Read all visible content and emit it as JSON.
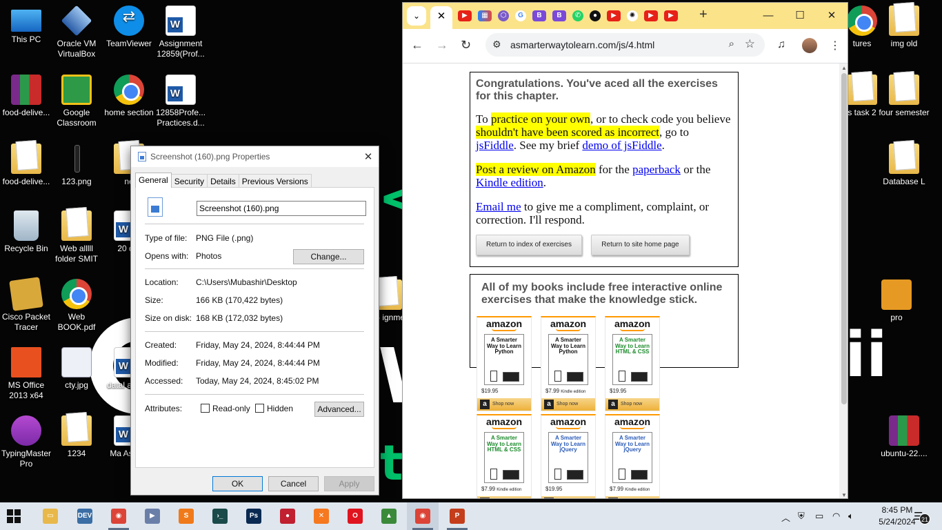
{
  "desktop": {
    "icons": {
      "this_pc": "This PC",
      "vbox": "Oracle VM VirtualBox",
      "teamviewer": "TeamViewer",
      "assignment": "Assignment 12859(Prof...",
      "food1": "food-delive...",
      "classroom": "Google Classroom",
      "home_section": "home section",
      "practices": "12858Profe... Practices.d...",
      "food2": "food-delive...",
      "png123": "123.png",
      "ne": "ne",
      "recycle": "Recycle Bin",
      "web_folder": "Web alllll folder   SMIT",
      "twenty": "20 dat",
      "cisco": "Cisco Packet Tracer",
      "web_book": "Web BOOK.pdf",
      "office": "MS Office 2013 x64",
      "cty": "cty.jpg",
      "datab": "datal assign",
      "typing": "TypingMaster Pro",
      "n1234": "1234",
      "ma": "Ma Assign",
      "js": "Js- ignme",
      "tures": "tures",
      "img_old": "img old",
      "s_task2": "s task 2",
      "four_sem": "four semester",
      "database": "Database L",
      "pro": "pro",
      "ubuntu": "ubuntu-22...."
    }
  },
  "properties_dialog": {
    "title": "Screenshot (160).png Properties",
    "tabs": [
      "General",
      "Security",
      "Details",
      "Previous Versions"
    ],
    "filename": "Screenshot (160).png",
    "type_label": "Type of file:",
    "type_value": "PNG File (.png)",
    "opens_label": "Opens with:",
    "opens_value": "Photos",
    "change_button": "Change...",
    "location_label": "Location:",
    "location_value": "C:\\Users\\Mubashir\\Desktop",
    "size_label": "Size:",
    "size_value": "166 KB (170,422 bytes)",
    "size_disk_label": "Size on disk:",
    "size_disk_value": "168 KB (172,032 bytes)",
    "created_label": "Created:",
    "created_value": "Friday, May 24, 2024, 8:44:44 PM",
    "modified_label": "Modified:",
    "modified_value": "Friday, May 24, 2024, 8:44:44 PM",
    "accessed_label": "Accessed:",
    "accessed_value": "Today, May 24, 2024, 8:45:02 PM",
    "attributes_label": "Attributes:",
    "readonly_label": "Read-only",
    "hidden_label": "Hidden",
    "advanced_button": "Advanced...",
    "ok_button": "OK",
    "cancel_button": "Cancel",
    "apply_button": "Apply"
  },
  "browser": {
    "url": "asmarterwaytolearn.com/js/4.html",
    "favicons": [
      "youtube",
      "jira",
      "proton",
      "google",
      "bing",
      "bing",
      "whatsapp",
      "github",
      "youtube",
      "chatgpt",
      "youtube",
      "youtube"
    ],
    "page": {
      "congrats_heading": "Congratulations. You've aced all the exercises for this chapter.",
      "p1_a": "To ",
      "p1_hl1": "practice on your own",
      "p1_b": ", or to check code you believe ",
      "p1_hl2": "shouldn't have been scored as incorrect",
      "p1_c": ", go to ",
      "p1_link1": "jsFiddle",
      "p1_d": ". See my brief ",
      "p1_link2": "demo of jsFiddle",
      "p1_e": ".",
      "p2_hl": "Post a review on Amazon",
      "p2_a": " for the ",
      "p2_link1": "paperback",
      "p2_b": " or the ",
      "p2_link2": "Kindle edition",
      "p2_c": ".",
      "p3_link": "Email me",
      "p3_a": " to give me a compliment, complaint, or correction. I'll respond.",
      "btn_index": "Return to index of exercises",
      "btn_home": "Return to site home page",
      "books_heading": "All of my books include free interactive online exercises that make the knowledge stick.",
      "books": [
        {
          "brand": "amazon",
          "title": "A Smarter Way to Learn Python",
          "price": "$19.95",
          "edition": "",
          "shop": "Shop now",
          "color": "#111111"
        },
        {
          "brand": "amazon",
          "title": "A Smarter Way to Learn Python",
          "price": "$7.99",
          "edition": "Kindle edition",
          "shop": "Shop now",
          "color": "#111111"
        },
        {
          "brand": "amazon",
          "title": "A Smarter Way to Learn HTML & CSS",
          "price": "$19.95",
          "edition": "",
          "shop": "Shop now",
          "color": "#1a8a2a"
        },
        {
          "brand": "amazon",
          "title": "A Smarter Way to Learn HTML & CSS",
          "price": "$7.99",
          "edition": "Kindle edition",
          "shop": "",
          "color": "#1a8a2a"
        },
        {
          "brand": "amazon",
          "title": "A Smarter Way to Learn jQuery",
          "price": "$19.95",
          "edition": "",
          "shop": "",
          "color": "#2a5ab8"
        },
        {
          "brand": "amazon",
          "title": "A Smarter Way to Learn jQuery",
          "price": "$7.99",
          "edition": "Kindle edition",
          "shop": "",
          "color": "#2a5ab8"
        }
      ]
    }
  },
  "taskbar": {
    "apps": [
      "file-explorer",
      "dev-c++",
      "chrome",
      "media-player",
      "sublime-text",
      "terminal",
      "photoshop",
      "screen-recorder",
      "xampp",
      "opera",
      "photos",
      "chrome",
      "powerpoint"
    ],
    "time": "8:45 PM",
    "date": "5/24/2024",
    "notifications": "21"
  }
}
